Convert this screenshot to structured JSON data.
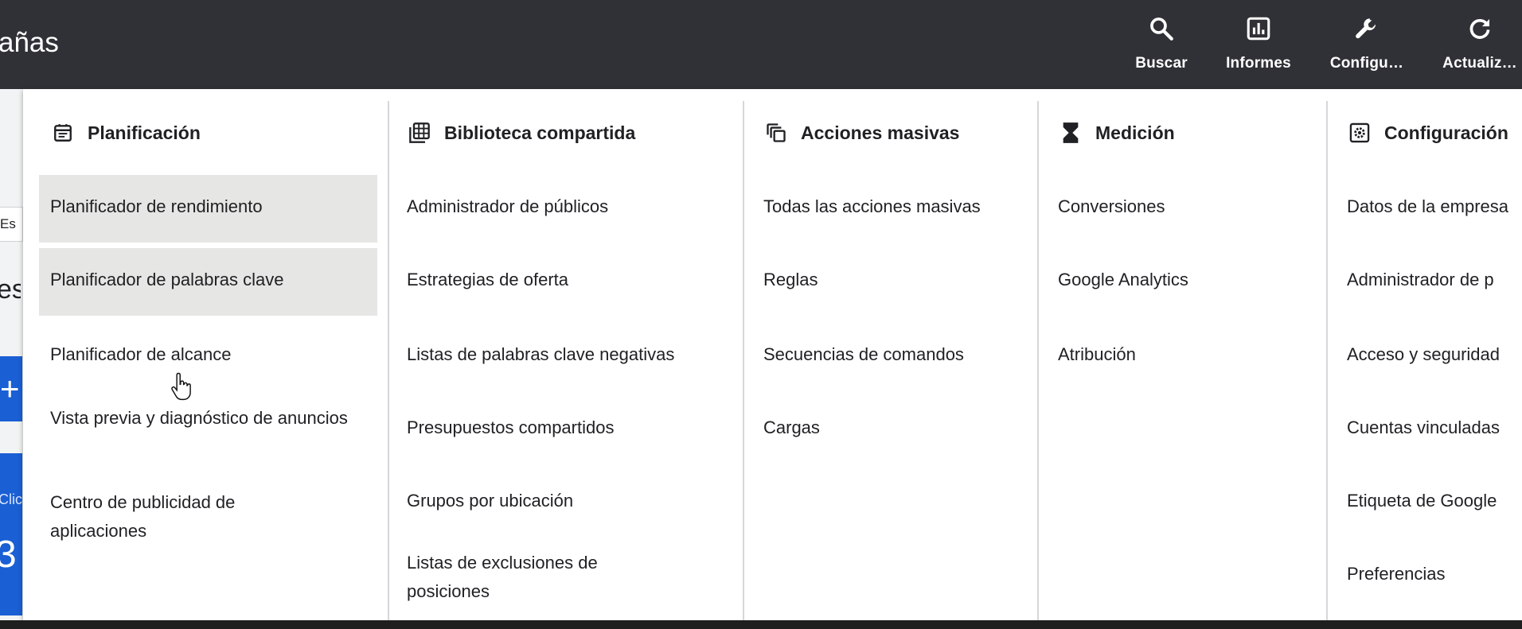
{
  "topbar": {
    "title": "añas",
    "tools": [
      {
        "label": "Buscar",
        "icon": "search-icon"
      },
      {
        "label": "Informes",
        "icon": "reports-icon"
      },
      {
        "label": "Configu…",
        "icon": "wrench-icon"
      },
      {
        "label": "Actualiz…",
        "icon": "refresh-icon"
      }
    ]
  },
  "background": {
    "chip_text": "Es",
    "heading_text": "es",
    "plus_text": "+",
    "card_label": "Clic",
    "card_number": "3"
  },
  "columns": [
    {
      "title": "Planificación",
      "icon": "calendar-icon",
      "items": [
        "Planificador de rendimiento",
        "Planificador de palabras clave",
        "Planificador de alcance",
        "Vista previa y diagnóstico de anuncios",
        "Centro de publicidad de aplicaciones"
      ]
    },
    {
      "title": "Biblioteca compartida",
      "icon": "library-grid-icon",
      "items": [
        "Administrador de públicos",
        "Estrategias de oferta",
        "Listas de palabras clave negativas",
        "Presupuestos compartidos",
        "Grupos por ubicación",
        "Listas de exclusiones de posiciones"
      ]
    },
    {
      "title": "Acciones masivas",
      "icon": "copy-stack-icon",
      "items": [
        "Todas las acciones masivas",
        "Reglas",
        "Secuencias de comandos",
        "Cargas"
      ]
    },
    {
      "title": "Medición",
      "icon": "hourglass-icon",
      "items": [
        "Conversiones",
        "Google Analytics",
        "Atribución"
      ]
    },
    {
      "title": "Configuración",
      "icon": "settings-gear-icon",
      "items": [
        "Datos de la empresa",
        "Administrador de p",
        "Acceso y seguridad",
        "Cuentas vinculadas",
        "Etiqueta de Google",
        "Preferencias"
      ]
    }
  ],
  "highlighted_items": [
    "Planificador de rendimiento",
    "Planificador de palabras clave"
  ]
}
